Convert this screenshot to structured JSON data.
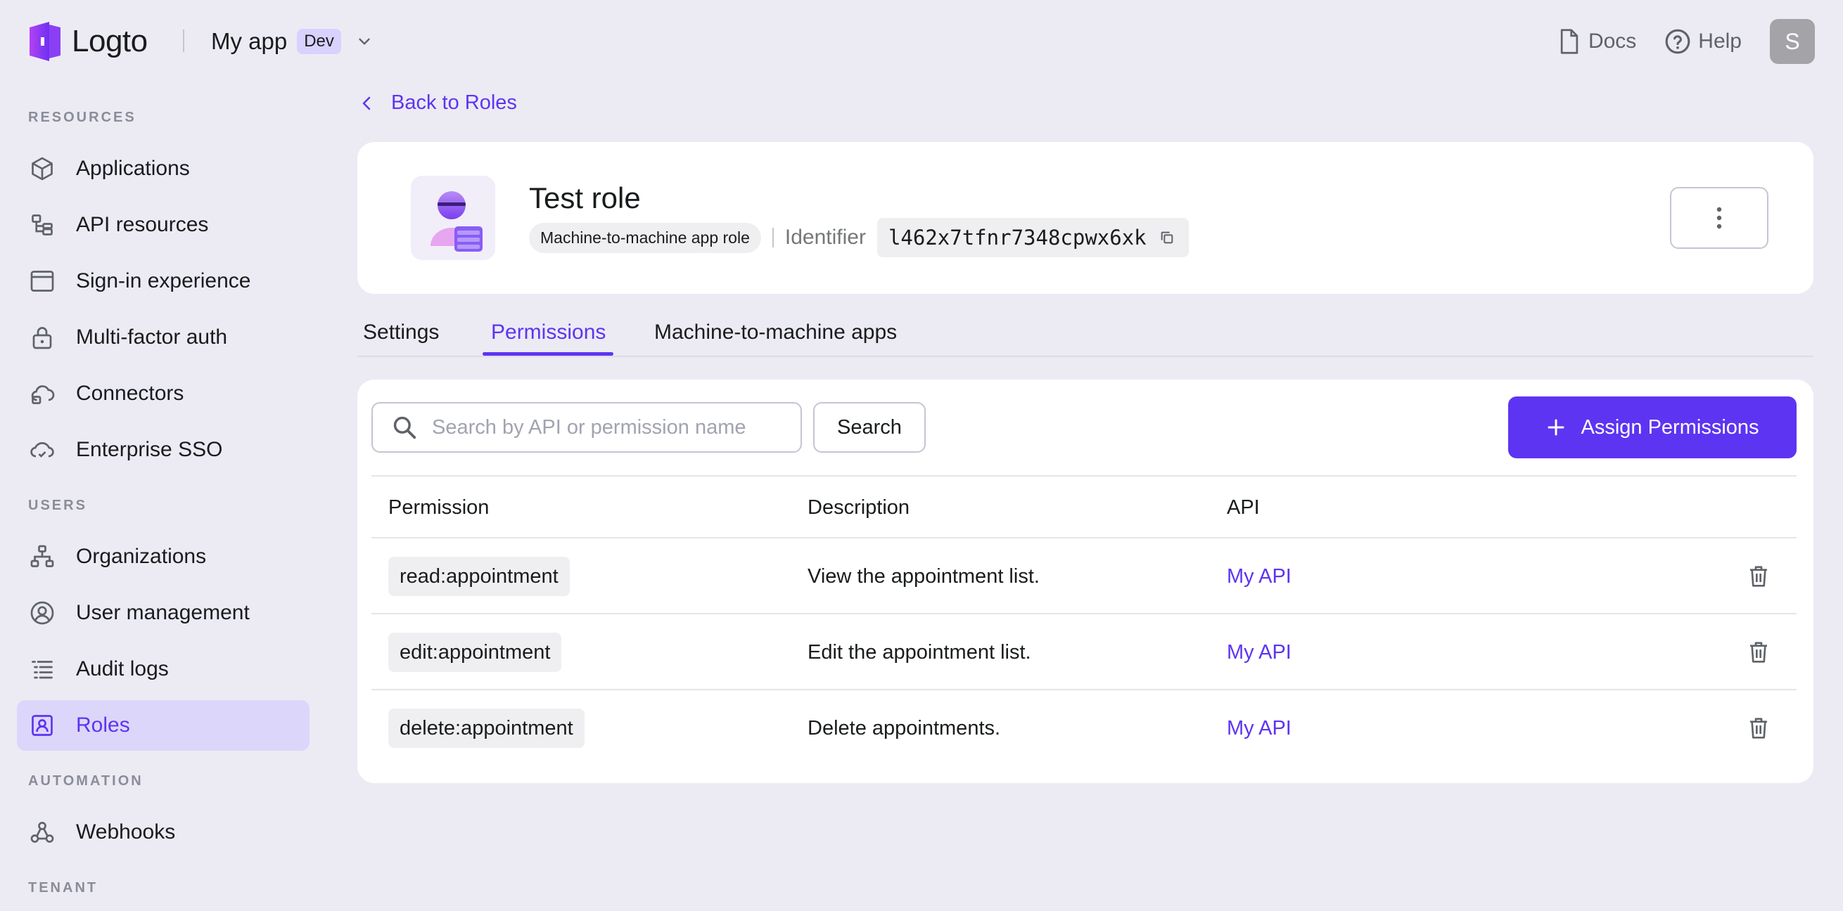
{
  "topbar": {
    "brand": "Logto",
    "app_name": "My app",
    "env_badge": "Dev",
    "docs": "Docs",
    "help": "Help",
    "avatar_initial": "S"
  },
  "sidebar": {
    "sections": {
      "resources": "RESOURCES",
      "users": "USERS",
      "automation": "AUTOMATION",
      "tenant": "TENANT"
    },
    "items": [
      {
        "label": "Applications",
        "icon": "cube-icon"
      },
      {
        "label": "API resources",
        "icon": "api-resource-icon"
      },
      {
        "label": "Sign-in experience",
        "icon": "browser-window-icon"
      },
      {
        "label": "Multi-factor auth",
        "icon": "lock-icon"
      },
      {
        "label": "Connectors",
        "icon": "connector-icon"
      },
      {
        "label": "Enterprise SSO",
        "icon": "cloud-sso-icon"
      },
      {
        "label": "Organizations",
        "icon": "org-tree-icon"
      },
      {
        "label": "User management",
        "icon": "user-circle-icon"
      },
      {
        "label": "Audit logs",
        "icon": "list-icon"
      },
      {
        "label": "Roles",
        "icon": "role-badge-icon",
        "active": true
      },
      {
        "label": "Webhooks",
        "icon": "webhook-icon"
      }
    ]
  },
  "main": {
    "back_link": "Back to Roles",
    "role": {
      "name": "Test role",
      "type_tag": "Machine-to-machine app role",
      "identifier_label": "Identifier",
      "identifier": "l462x7tfnr7348cpwx6xk"
    },
    "tabs": [
      {
        "label": "Settings"
      },
      {
        "label": "Permissions",
        "active": true
      },
      {
        "label": "Machine-to-machine apps"
      }
    ],
    "search": {
      "placeholder": "Search by API or permission name",
      "value": "",
      "button": "Search"
    },
    "assign_button": "Assign Permissions",
    "table": {
      "columns": [
        "Permission",
        "Description",
        "API"
      ],
      "rows": [
        {
          "permission": "read:appointment",
          "description": "View the appointment list.",
          "api": "My API"
        },
        {
          "permission": "edit:appointment",
          "description": "Edit the appointment list.",
          "api": "My API"
        },
        {
          "permission": "delete:appointment",
          "description": "Delete appointments.",
          "api": "My API"
        }
      ]
    }
  },
  "colors": {
    "accent": "#5d34f2",
    "background": "#ecebf4",
    "active_nav_bg": "#ddd6fb"
  }
}
